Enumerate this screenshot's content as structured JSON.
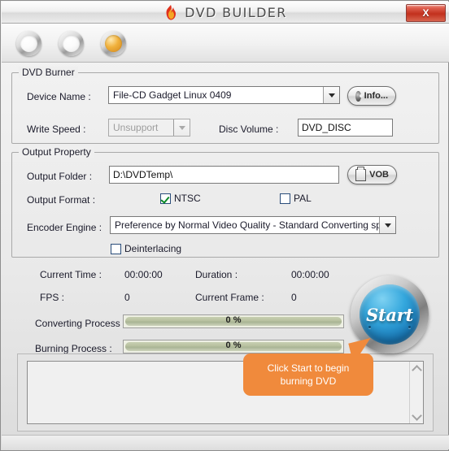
{
  "window": {
    "title": "DVD BUILDER",
    "close_label": "X",
    "accent_orange": "#f08a3c",
    "accent_blue": "#1b7cbb"
  },
  "toolbar": {
    "buttons": [
      {
        "name": "toolbar-button-1",
        "state": "inactive"
      },
      {
        "name": "toolbar-button-2",
        "state": "inactive"
      },
      {
        "name": "toolbar-button-3",
        "state": "active"
      }
    ]
  },
  "dvd_burner": {
    "group_title": "DVD Burner",
    "device_name_label": "Device Name :",
    "device_name_value": "File-CD Gadget   Linux    0409",
    "info_button_label": "Info...",
    "write_speed_label": "Write Speed :",
    "write_speed_value": "Unsupport",
    "disc_volume_label": "Disc Volume :",
    "disc_volume_value": "DVD_DISC"
  },
  "output_property": {
    "group_title": "Output Property",
    "output_folder_label": "Output Folder :",
    "output_folder_value": "D:\\DVDTemp\\",
    "vob_button_label": "VOB",
    "output_format_label": "Output Format :",
    "format_ntsc_label": "NTSC",
    "format_pal_label": "PAL",
    "format_ntsc_checked": true,
    "format_pal_checked": false,
    "encoder_engine_label": "Encoder Engine :",
    "encoder_engine_value": "Preference by Normal Video Quality - Standard Converting speed",
    "deinterlacing_label": "Deinterlacing",
    "deinterlacing_checked": false
  },
  "status": {
    "current_time_label": "Current Time :",
    "current_time_value": "00:00:00",
    "duration_label": "Duration :",
    "duration_value": "00:00:00",
    "fps_label": "FPS :",
    "fps_value": "0",
    "current_frame_label": "Current Frame :",
    "current_frame_value": "0",
    "converting_label": "Converting Process :",
    "converting_value": "0 %",
    "converting_percent": 0,
    "burning_label": "Burning Process :",
    "burning_value": "0 %",
    "burning_percent": 0
  },
  "start": {
    "label": "Start"
  },
  "tooltip": {
    "text": "Click Start to begin burning DVD"
  },
  "log": {
    "content": ""
  }
}
